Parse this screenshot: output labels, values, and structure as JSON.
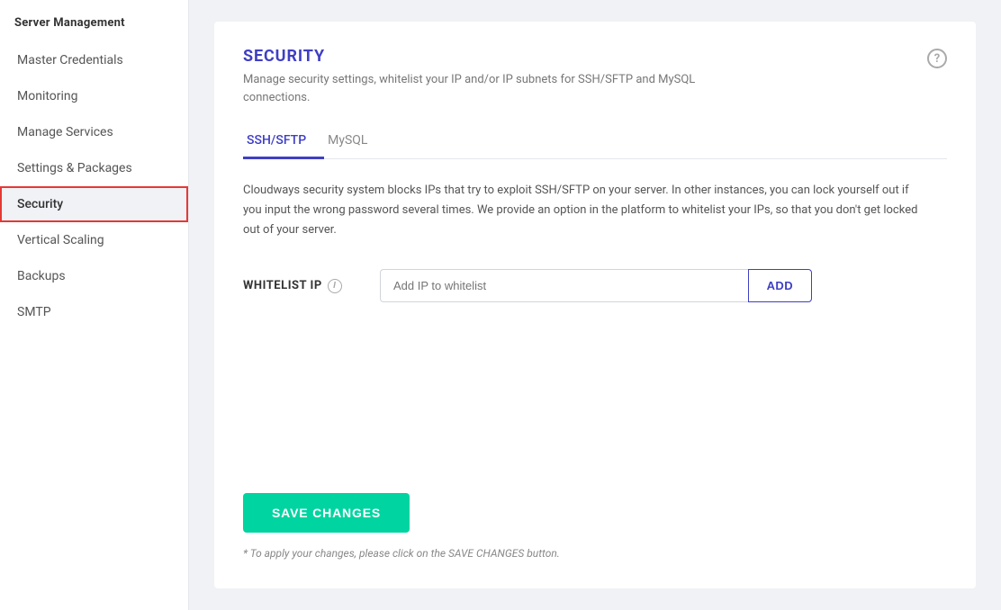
{
  "sidebar": {
    "title": "Server Management",
    "items": [
      {
        "id": "master-credentials",
        "label": "Master Credentials",
        "active": false
      },
      {
        "id": "monitoring",
        "label": "Monitoring",
        "active": false
      },
      {
        "id": "manage-services",
        "label": "Manage Services",
        "active": false
      },
      {
        "id": "settings-packages",
        "label": "Settings & Packages",
        "active": false
      },
      {
        "id": "security",
        "label": "Security",
        "active": true
      },
      {
        "id": "vertical-scaling",
        "label": "Vertical Scaling",
        "active": false
      },
      {
        "id": "backups",
        "label": "Backups",
        "active": false
      },
      {
        "id": "smtp",
        "label": "SMTP",
        "active": false
      }
    ]
  },
  "page": {
    "title": "SECURITY",
    "description": "Manage security settings, whitelist your IP and/or IP subnets for SSH/SFTP and MySQL connections.",
    "help_label": "?"
  },
  "tabs": [
    {
      "id": "ssh-sftp",
      "label": "SSH/SFTP",
      "active": true
    },
    {
      "id": "mysql",
      "label": "MySQL",
      "active": false
    }
  ],
  "section": {
    "description": "Cloudways security system blocks IPs that try to exploit SSH/SFTP on your server. In other instances, you can lock yourself out if you input the wrong password several times. We provide an option in the platform to whitelist your IPs, so that you don't get locked out of your server."
  },
  "whitelist": {
    "label": "WHITELIST IP",
    "info_icon": "i",
    "input_placeholder": "Add IP to whitelist",
    "add_button_label": "ADD"
  },
  "footer": {
    "save_button_label": "SAVE CHANGES",
    "note": "* To apply your changes, please click on the SAVE CHANGES button."
  }
}
